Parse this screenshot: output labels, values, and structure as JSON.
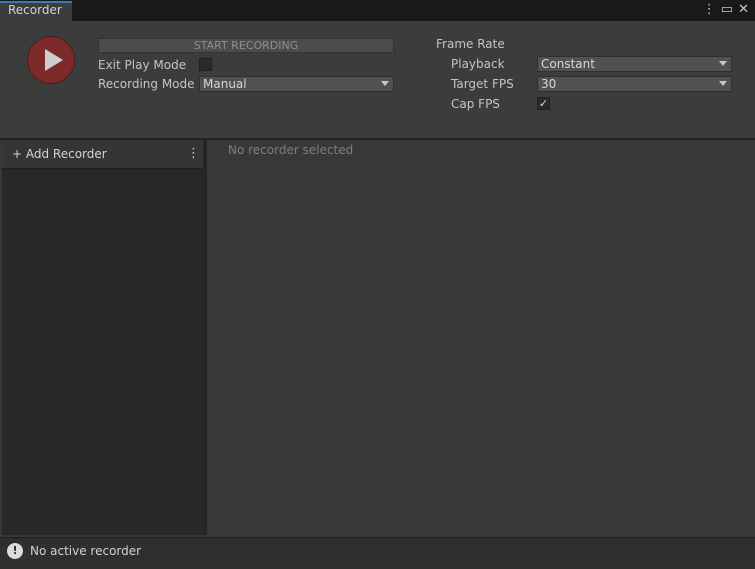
{
  "window": {
    "tab_title": "Recorder",
    "icons": [
      "kebab-menu-icon",
      "maximize-icon",
      "close-icon"
    ]
  },
  "controls": {
    "start_recording_label": "START RECORDING",
    "exit_play_mode_label": "Exit Play Mode",
    "exit_play_mode_checked": false,
    "recording_mode_label": "Recording Mode",
    "recording_mode_value": "Manual"
  },
  "frame_rate": {
    "section_label": "Frame Rate",
    "playback_label": "Playback",
    "playback_value": "Constant",
    "target_fps_label": "Target FPS",
    "target_fps_value": "30",
    "cap_fps_label": "Cap FPS",
    "cap_fps_checked": true
  },
  "recorder_list": {
    "add_recorder_label": "+ Add Recorder",
    "empty_selection_text": "No recorder selected"
  },
  "status_bar": {
    "icon_glyph": "!",
    "text": "No active recorder"
  },
  "colors": {
    "accent": "#3a79bb",
    "play_button": "#7c2a2a"
  }
}
